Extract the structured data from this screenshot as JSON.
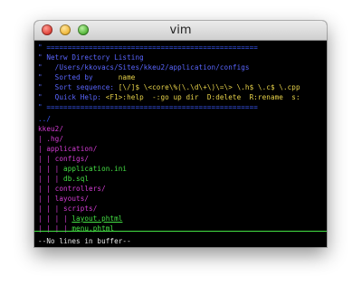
{
  "window": {
    "title": "vim"
  },
  "header": {
    "rule1": "\" ==================================================",
    "title": "\" Netrw Directory Listing",
    "path": "\"   /Users/kkovacs/Sites/kkeu2/application/configs",
    "sorted_label": "\"   Sorted by      ",
    "sorted_value": "name",
    "sort_label": "\"   Sort sequence: ",
    "sort_value": "[\\/]$ \\<core\\%(\\.\\d\\+\\)\\=\\> \\.h$ \\.c$ \\.cpp",
    "help_label": "\"   Quick Help: ",
    "help_value": "<F1>:help  -:go up dir  D:delete  R:rename  s:",
    "rule2": "\" =================================================="
  },
  "tree": {
    "parent": "../",
    "root": "kkeu2/",
    "items": [
      {
        "prefix": "| ",
        "name": ".hg/",
        "dir": true
      },
      {
        "prefix": "| ",
        "name": "application/",
        "dir": true
      },
      {
        "prefix": "| | ",
        "name": "configs/",
        "dir": true
      },
      {
        "prefix": "| | | ",
        "name": "application.ini",
        "dir": false
      },
      {
        "prefix": "| | | ",
        "name": "db.sql",
        "dir": false
      },
      {
        "prefix": "| | ",
        "name": "controllers/",
        "dir": true
      },
      {
        "prefix": "| | ",
        "name": "layouts/",
        "dir": true
      },
      {
        "prefix": "| | | ",
        "name": "scripts/",
        "dir": true
      },
      {
        "prefix": "| | | | ",
        "name": "layout.phtml",
        "dir": false
      },
      {
        "prefix": "| | | | ",
        "name": "menu.phtml",
        "dir": false
      }
    ]
  },
  "status": {
    "message": "--No lines in buffer--"
  },
  "colors": {
    "comment": "#3b5bff",
    "highlight": "#e8d34a",
    "directory": "#d43cd4",
    "file": "#44e044"
  }
}
